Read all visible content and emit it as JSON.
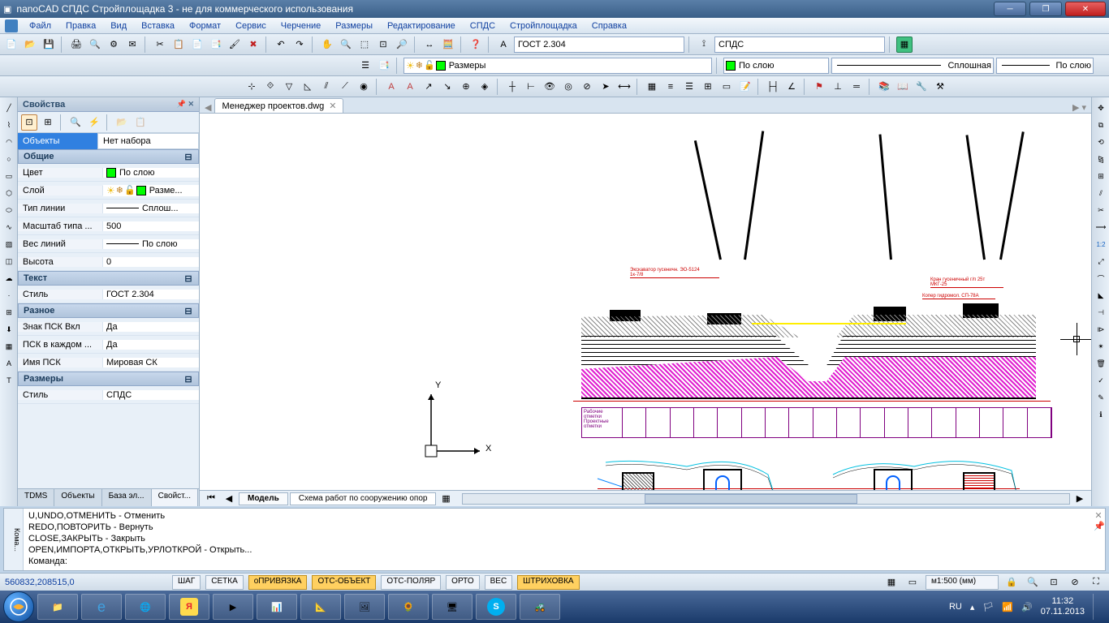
{
  "title": "nanoCAD СПДС Стройплощадка 3 - не для коммерческого использования",
  "menu": [
    "Файл",
    "Правка",
    "Вид",
    "Вставка",
    "Формат",
    "Сервис",
    "Черчение",
    "Размеры",
    "Редактирование",
    "СПДС",
    "Стройплощадка",
    "Справка"
  ],
  "text_style_combo": "ГОСТ 2.304",
  "dim_style_combo": "СПДС",
  "layer_combo": "Размеры",
  "bylayer": "По слою",
  "linetype": "Сплошная",
  "lineweight": "По слою",
  "properties": {
    "title": "Свойства",
    "objects_label": "Объекты",
    "no_set": "Нет набора",
    "sections": {
      "general": "Общие",
      "text": "Текст",
      "misc": "Разное",
      "dims": "Размеры"
    },
    "rows": {
      "color": {
        "label": "Цвет",
        "value": "По слою"
      },
      "layer": {
        "label": "Слой",
        "value": "Разме..."
      },
      "linetype": {
        "label": "Тип линии",
        "value": "Сплош..."
      },
      "ltscale": {
        "label": "Масштаб типа ...",
        "value": "500"
      },
      "lineweight": {
        "label": "Вес линий",
        "value": "По слою"
      },
      "height": {
        "label": "Высота",
        "value": "0"
      },
      "textstyle": {
        "label": "Стиль",
        "value": "ГОСТ 2.304"
      },
      "ucs_icon": {
        "label": "Знак ПСК Вкл",
        "value": "Да"
      },
      "ucs_each": {
        "label": "ПСК в каждом ...",
        "value": "Да"
      },
      "ucs_name": {
        "label": "Имя ПСК",
        "value": "Мировая СК"
      },
      "dimstyle": {
        "label": "Стиль",
        "value": "СПДС"
      }
    },
    "tabs": [
      "TDMS",
      "Объекты",
      "База эл...",
      "Свойст..."
    ]
  },
  "doc_tab": "Менеджер проектов.dwg",
  "model_tabs": [
    "Модель",
    "Схема работ по сооружению опор"
  ],
  "command_lines": [
    "U,UNDO,ОТМЕНИТЬ - Отменить",
    "REDO,ПОВТОРИТЬ - Вернуть",
    "CLOSE,ЗАКРЫТЬ - Закрыть",
    "OPEN,ИМПОРТА,ОТКРЫТЬ,УРЛОТКРОЙ - Открыть..."
  ],
  "command_prompt": "Команда:",
  "command_label": "Кома...",
  "status": {
    "coords": "560832,208515,0",
    "buttons": [
      {
        "label": "ШАГ",
        "on": false
      },
      {
        "label": "СЕТКА",
        "on": false
      },
      {
        "label": "оПРИВЯЗКА",
        "on": true
      },
      {
        "label": "ОТС-ОБЪЕКТ",
        "on": true
      },
      {
        "label": "ОТС-ПОЛЯР",
        "on": false
      },
      {
        "label": "ОРТО",
        "on": false
      },
      {
        "label": "ВЕС",
        "on": false
      },
      {
        "label": "ШТРИХОВКА",
        "on": true
      }
    ],
    "scale": "м1:500 (мм)"
  },
  "tray": {
    "lang": "RU",
    "time": "11:32",
    "date": "07.11.2013"
  },
  "ucs": {
    "x": "X",
    "y": "Y"
  },
  "right_tools": [
    "1:2"
  ]
}
